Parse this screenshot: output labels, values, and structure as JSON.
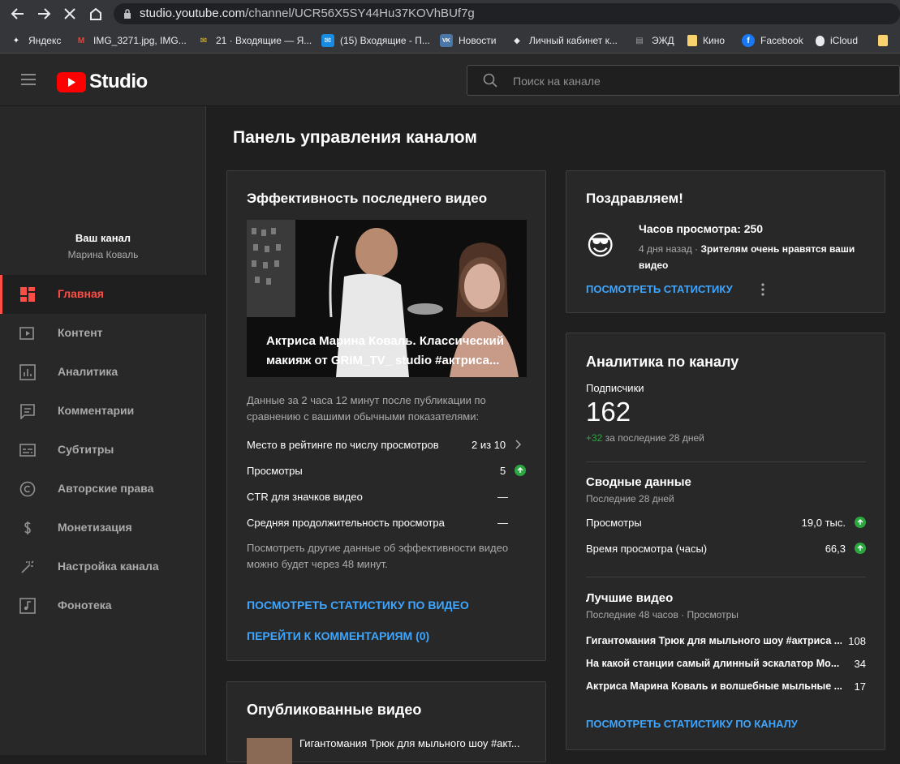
{
  "browser": {
    "url_host": "studio.youtube.com",
    "url_path": "/channel/UCR56X5SY44Hu37KOVhBUf7g",
    "bookmarks": [
      {
        "label": "Яндекс",
        "icon": "yandex-icon",
        "color": "#ffffff"
      },
      {
        "label": "IMG_3271.jpg, IMG...",
        "icon": "gmail-icon",
        "color": "#ea4335"
      },
      {
        "label": "21 · Входящие — Я...",
        "icon": "yandex-mail-icon",
        "color": "#f5c518"
      },
      {
        "label": "(15) Входящие - П...",
        "icon": "mail-icon",
        "color": "#168de2"
      },
      {
        "label": "Новости",
        "icon": "vk-icon",
        "color": "#4a76a8"
      },
      {
        "label": "Личный кабинет к...",
        "icon": "bank-icon",
        "color": "#e8eaed"
      },
      {
        "label": "ЭЖД",
        "icon": "document-icon",
        "color": "#9aa0a6"
      },
      {
        "label": "Кино",
        "icon": "folder-icon",
        "color": "#f9d26e"
      },
      {
        "label": "Facebook",
        "icon": "facebook-icon",
        "color": "#1877f2"
      },
      {
        "label": "iCloud",
        "icon": "apple-icon",
        "color": "#e8eaed"
      },
      {
        "label": "",
        "icon": "folder-icon",
        "color": "#f9d26e"
      }
    ]
  },
  "header": {
    "logo_text": "Studio",
    "search_placeholder": "Поиск на канале"
  },
  "sidebar": {
    "channel_title": "Ваш канал",
    "channel_name": "Марина Коваль",
    "items": [
      {
        "label": "Главная",
        "icon": "dashboard-icon",
        "active": true
      },
      {
        "label": "Контент",
        "icon": "content-icon"
      },
      {
        "label": "Аналитика",
        "icon": "analytics-icon"
      },
      {
        "label": "Комментарии",
        "icon": "comments-icon"
      },
      {
        "label": "Субтитры",
        "icon": "subtitles-icon"
      },
      {
        "label": "Авторские права",
        "icon": "copyright-icon"
      },
      {
        "label": "Монетизация",
        "icon": "dollar-icon"
      },
      {
        "label": "Настройка канала",
        "icon": "magic-wand-icon"
      },
      {
        "label": "Фонотека",
        "icon": "music-icon"
      }
    ]
  },
  "main": {
    "page_title": "Панель управления каналом",
    "latest": {
      "title": "Эффективность последнего видео",
      "video_title_line1": "Актриса Марина Коваль. Классический",
      "video_title_line2": "макияж от GRIM_TV_ studio #актриса...",
      "desc_line1": "Данные за 2 часа 12 минут после публикации по",
      "desc_line2": "сравнению с вашими обычными показателями:",
      "metrics": [
        {
          "label": "Место в рейтинге по числу просмотров",
          "value": "2 из 10"
        },
        {
          "label": "Просмотры",
          "value": "5"
        },
        {
          "label": "CTR для значков видео",
          "value": "—"
        },
        {
          "label": "Средняя продолжительность просмотра",
          "value": "—"
        }
      ],
      "note_line1": "Посмотреть другие данные об эффективности видео",
      "note_line2": "можно будет через 48 минут.",
      "link_stats": "ПОСМОТРЕТЬ СТАТИСТИКУ ПО ВИДЕО",
      "link_comments": "ПЕРЕЙТИ К КОММЕНТАРИЯМ (0)"
    },
    "published": {
      "title": "Опубликованные видео",
      "first_video": "Гигантомания Трюк для мыльного шоу #акт..."
    },
    "congrats": {
      "title": "Поздравляем!",
      "headline": "Часов просмотра: 250",
      "when": "4 дня назад",
      "bullet": "·",
      "message_line1": "Зрителям очень нравятся ваши",
      "message_line2": "видео",
      "link": "ПОСМОТРЕТЬ СТАТИСТИКУ",
      "emoji": "😎"
    },
    "analytics": {
      "title": "Аналитика по каналу",
      "subs_label": "Подписчики",
      "subs_value": "162",
      "subs_delta": "+32",
      "subs_period": "за последние 28 дней",
      "summary_title": "Сводные данные",
      "summary_period": "Последние 28 дней",
      "summary": [
        {
          "label": "Просмотры",
          "value": "19,0 тыс."
        },
        {
          "label": "Время просмотра (часы)",
          "value": "66,3"
        }
      ],
      "top_title": "Лучшие видео",
      "top_period": "Последние 48 часов · Просмотры",
      "top_videos": [
        {
          "title": "Гигантомания Трюк для мыльного шоу #актриса ...",
          "views": "108"
        },
        {
          "title": "На какой станции самый длинный эскалатор Мо...",
          "views": "34"
        },
        {
          "title": "Актриса Марина Коваль и волшебные мыльные ...",
          "views": "17"
        }
      ],
      "link": "ПОСМОТРЕТЬ СТАТИСТИКУ ПО КАНАЛУ"
    }
  }
}
